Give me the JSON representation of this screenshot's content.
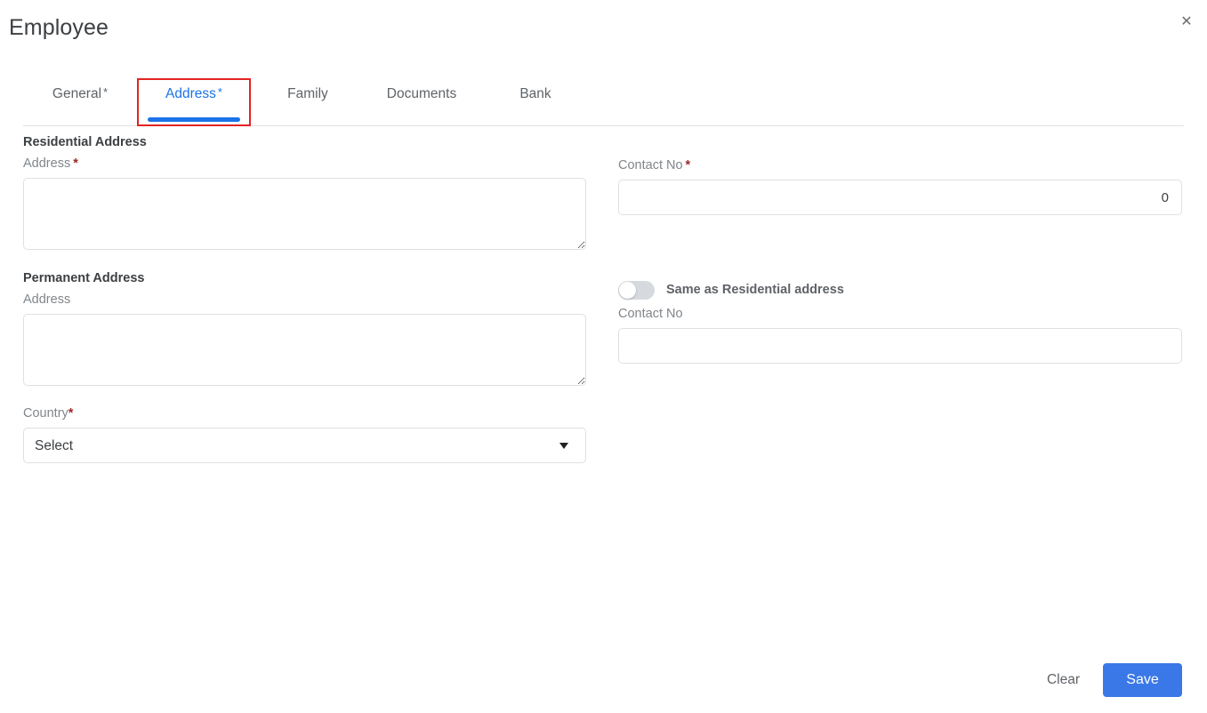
{
  "dialog": {
    "title": "Employee",
    "close_icon": "close-icon",
    "close_glyph": "✕"
  },
  "tabs": [
    {
      "label": "General",
      "required_marker": "*",
      "active": false
    },
    {
      "label": "Address",
      "required_marker": "*",
      "active": true
    },
    {
      "label": "Family",
      "required_marker": "",
      "active": false
    },
    {
      "label": "Documents",
      "required_marker": "",
      "active": false
    },
    {
      "label": "Bank",
      "required_marker": "",
      "active": false
    }
  ],
  "residential": {
    "section_title": "Residential Address",
    "address_label": "Address",
    "address_required": "*",
    "address_value": "",
    "address_placeholder": "",
    "contact_label": "Contact No",
    "contact_required": "*",
    "contact_value": "0",
    "contact_placeholder": ""
  },
  "permanent": {
    "section_title": "Permanent Address",
    "address_label": "Address",
    "address_value": "",
    "address_placeholder": "",
    "same_as_residential_label": "Same as Residential address",
    "same_as_residential_on": false,
    "contact_label": "Contact No",
    "contact_value": "",
    "contact_placeholder": ""
  },
  "country": {
    "label": "Country",
    "required_marker": "*",
    "selected": "Select",
    "options": [
      "Select"
    ],
    "caret_icon": "chevron-down-icon"
  },
  "footer": {
    "clear_label": "Clear",
    "save_label": "Save"
  },
  "colors": {
    "accent_blue": "#1a73e8",
    "save_blue": "#3b78e7",
    "focus_red": "#e32424",
    "required_red": "#9c2a28",
    "label_gray": "#80868b",
    "text_dark": "#3c4043"
  }
}
